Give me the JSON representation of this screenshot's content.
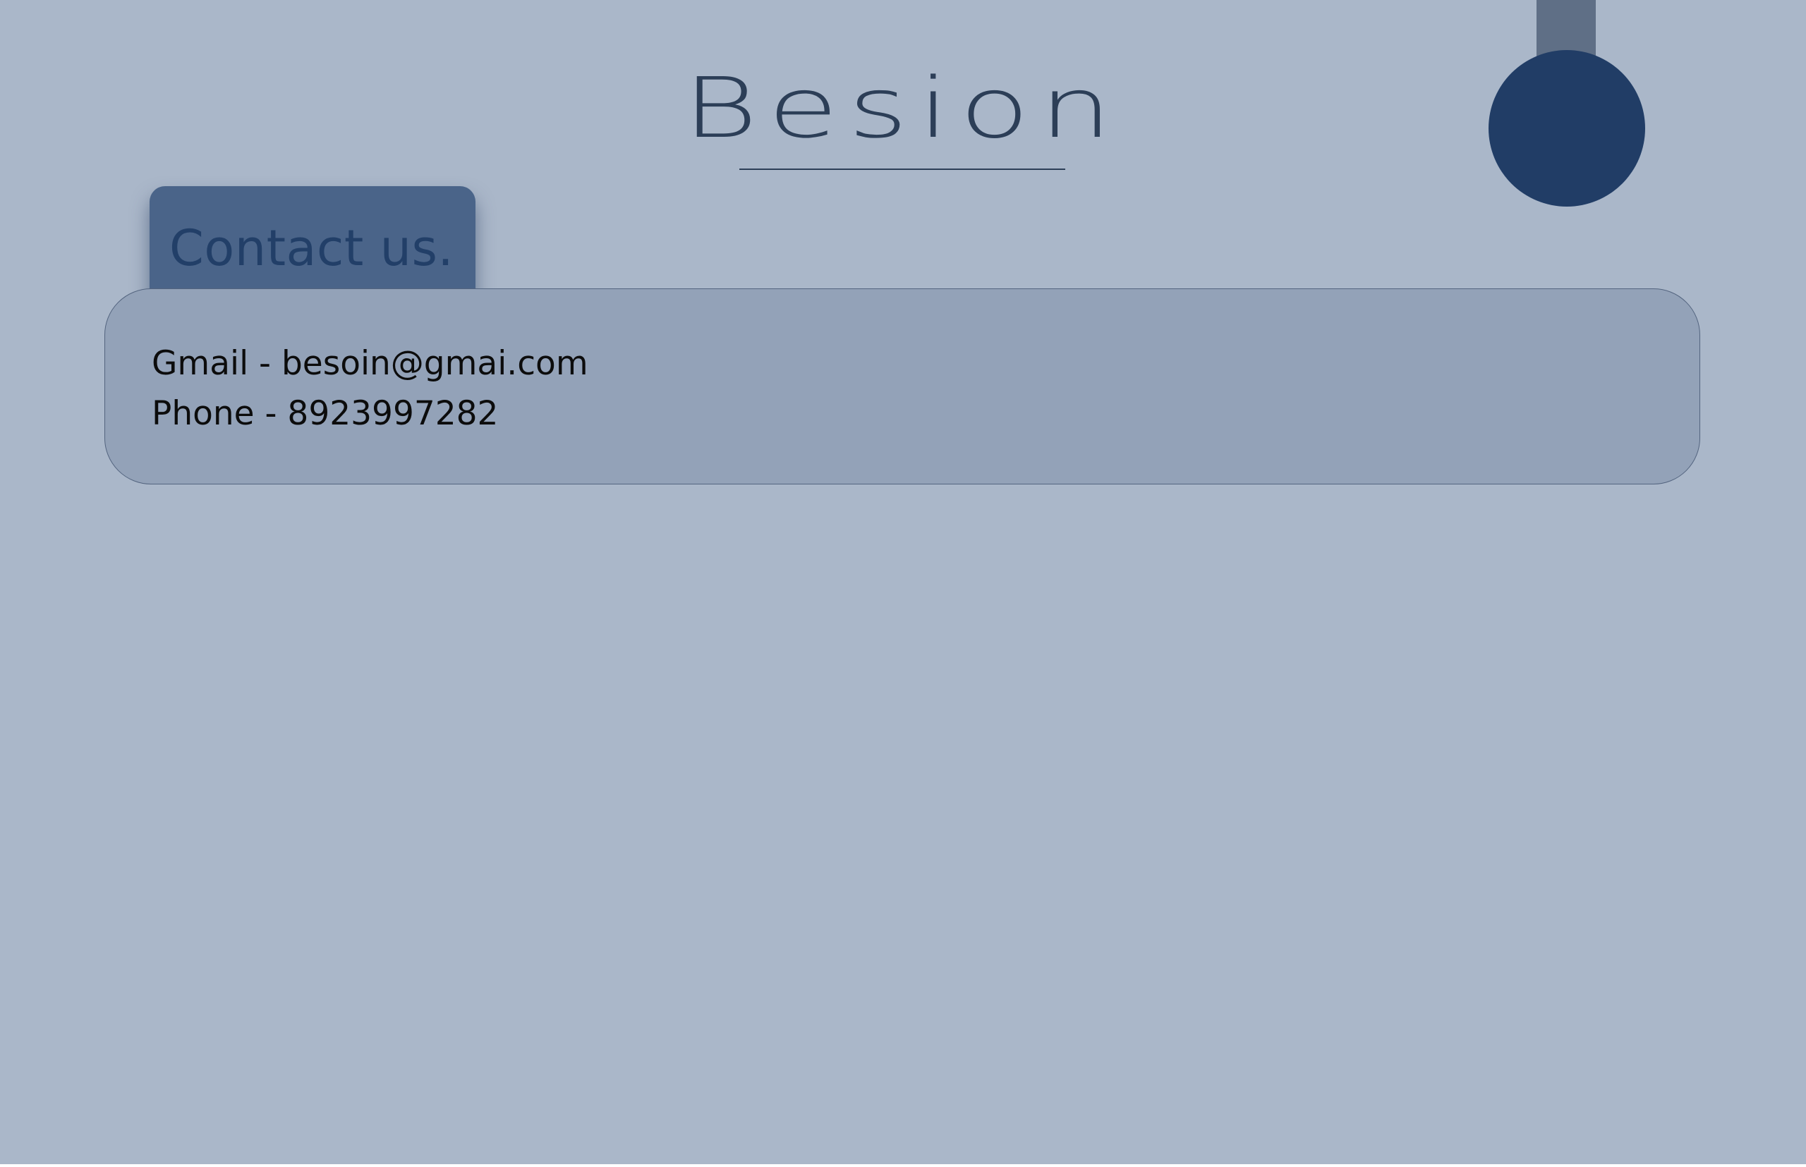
{
  "brand": {
    "title": "Besion"
  },
  "contact": {
    "tab_label": "Contact us.",
    "gmail_line": "Gmail - besoin@gmai.com",
    "phone_line": "Phone - 8923997282"
  },
  "colors": {
    "background": "#aab7c9",
    "brand_text": "#2c3e57",
    "tab": "#4a6489",
    "tab_text": "#223f68",
    "card": "#93a2b8",
    "card_border": "#53647f",
    "pendant_stem": "#5f6f86",
    "pendant_ball": "#213d66"
  },
  "decorations": {
    "pendant": "hanging-circle-ornament"
  }
}
